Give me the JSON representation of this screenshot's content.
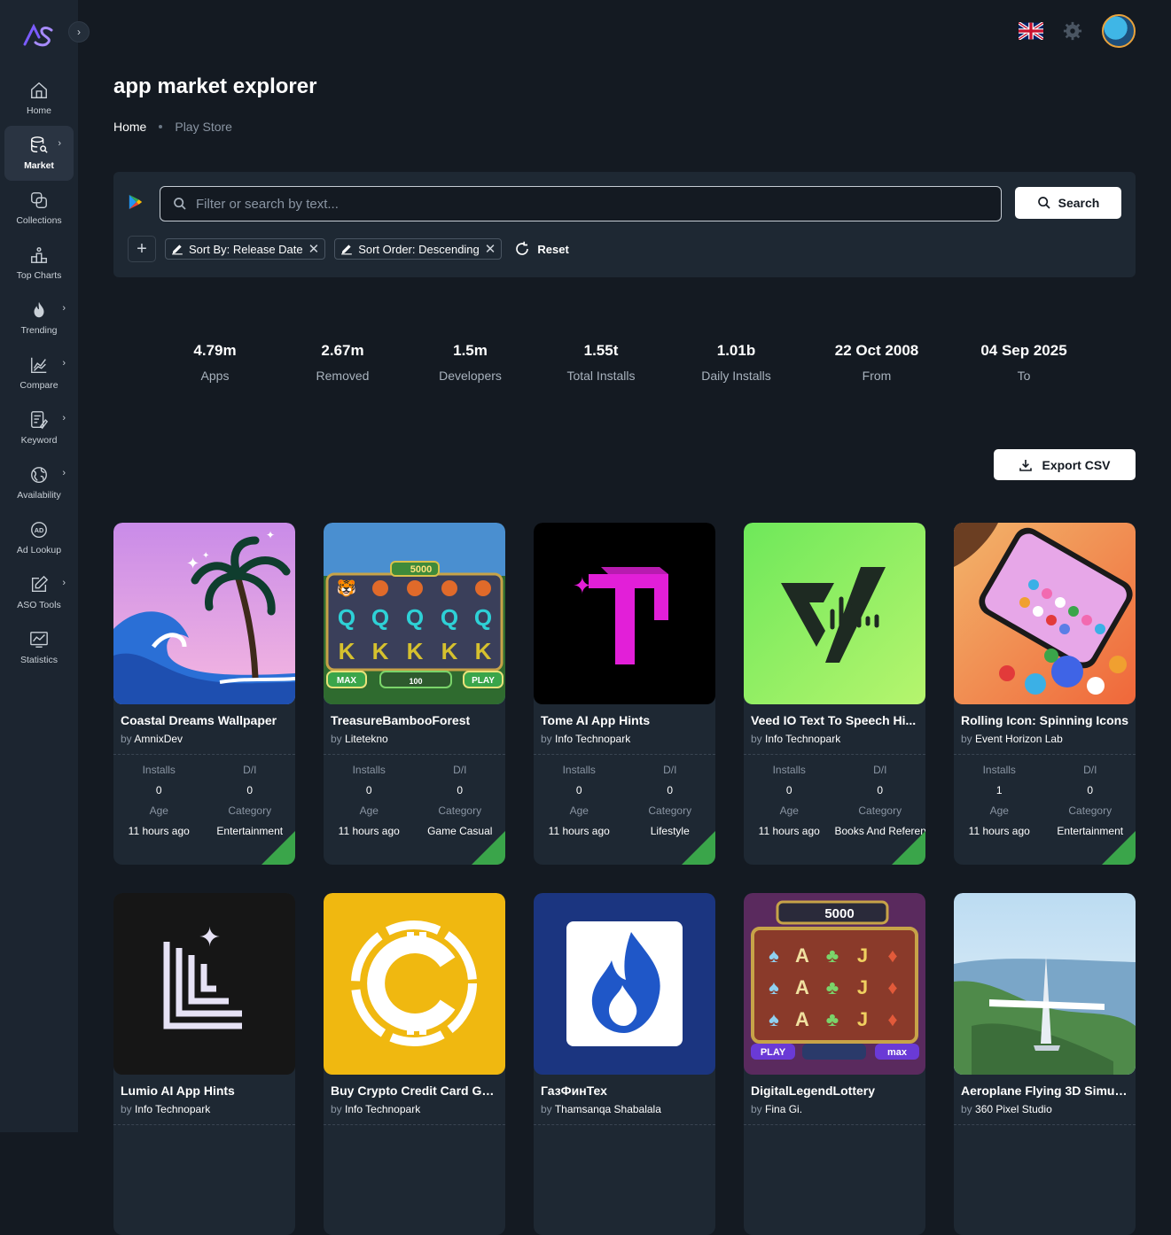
{
  "app": {
    "title": "app market explorer"
  },
  "sidebar": {
    "logo": "AS",
    "items": [
      {
        "label": "Home",
        "icon": "home-icon",
        "chevron": false
      },
      {
        "label": "Market",
        "icon": "database-search-icon",
        "chevron": true,
        "active": true
      },
      {
        "label": "Collections",
        "icon": "collections-icon",
        "chevron": false
      },
      {
        "label": "Top Charts",
        "icon": "podium-icon",
        "chevron": false
      },
      {
        "label": "Trending",
        "icon": "flame-icon",
        "chevron": true
      },
      {
        "label": "Compare",
        "icon": "line-chart-icon",
        "chevron": true
      },
      {
        "label": "Keyword",
        "icon": "keyword-icon",
        "chevron": true
      },
      {
        "label": "Availability",
        "icon": "globe-icon",
        "chevron": true
      },
      {
        "label": "Ad Lookup",
        "icon": "ad-icon",
        "chevron": false
      },
      {
        "label": "ASO Tools",
        "icon": "edit-icon",
        "chevron": true
      },
      {
        "label": "Statistics",
        "icon": "statistics-icon",
        "chevron": false
      }
    ]
  },
  "breadcrumb": {
    "home": "Home",
    "current": "Play Store"
  },
  "search": {
    "placeholder": "Filter or search by text...",
    "button": "Search"
  },
  "filters": {
    "chips": [
      "Sort By: Release Date",
      "Sort Order: Descending"
    ],
    "reset": "Reset"
  },
  "stats": [
    {
      "value": "4.79m",
      "label": "Apps"
    },
    {
      "value": "2.67m",
      "label": "Removed"
    },
    {
      "value": "1.5m",
      "label": "Developers"
    },
    {
      "value": "1.55t",
      "label": "Total Installs"
    },
    {
      "value": "1.01b",
      "label": "Daily Installs"
    },
    {
      "value": "22 Oct 2008",
      "label": "From"
    },
    {
      "value": "04 Sep 2025",
      "label": "To"
    }
  ],
  "export": {
    "label": "Export CSV"
  },
  "card_labels": {
    "by": "by",
    "installs": "Installs",
    "di": "D/I",
    "age": "Age",
    "category": "Category"
  },
  "apps": [
    {
      "name": "Coastal Dreams Wallpaper",
      "developer": "AmnixDev",
      "installs": "0",
      "di": "0",
      "age": "11 hours ago",
      "category": "Entertainment"
    },
    {
      "name": "TreasureBambooForest",
      "developer": "Litetekno",
      "installs": "0",
      "di": "0",
      "age": "11 hours ago",
      "category": "Game Casual"
    },
    {
      "name": "Tome AI App Hints",
      "developer": "Info Technopark",
      "installs": "0",
      "di": "0",
      "age": "11 hours ago",
      "category": "Lifestyle"
    },
    {
      "name": "Veed IO Text To Speech Hi...",
      "developer": "Info Technopark",
      "installs": "0",
      "di": "0",
      "age": "11 hours ago",
      "category": "Books And Reference"
    },
    {
      "name": "Rolling Icon: Spinning Icons",
      "developer": "Event Horizon Lab",
      "installs": "1",
      "di": "0",
      "age": "11 hours ago",
      "category": "Entertainment"
    },
    {
      "name": "Lumio AI App Hints",
      "developer": "Info Technopark"
    },
    {
      "name": "Buy Crypto Credit Card Gu...",
      "developer": "Info Technopark"
    },
    {
      "name": "ГазФинТех",
      "developer": "Thamsanqa Shabalala"
    },
    {
      "name": "DigitalLegendLottery",
      "developer": "Fina Gi."
    },
    {
      "name": "Aeroplane Flying 3D Simul...",
      "developer": "360 Pixel Studio"
    }
  ],
  "slot_texts": {
    "jackpot1": "5000",
    "max": "MAX",
    "bet": "100",
    "play": "PLAY",
    "jackpot2": "5000",
    "play2": "PLAY",
    "max2": "max"
  }
}
